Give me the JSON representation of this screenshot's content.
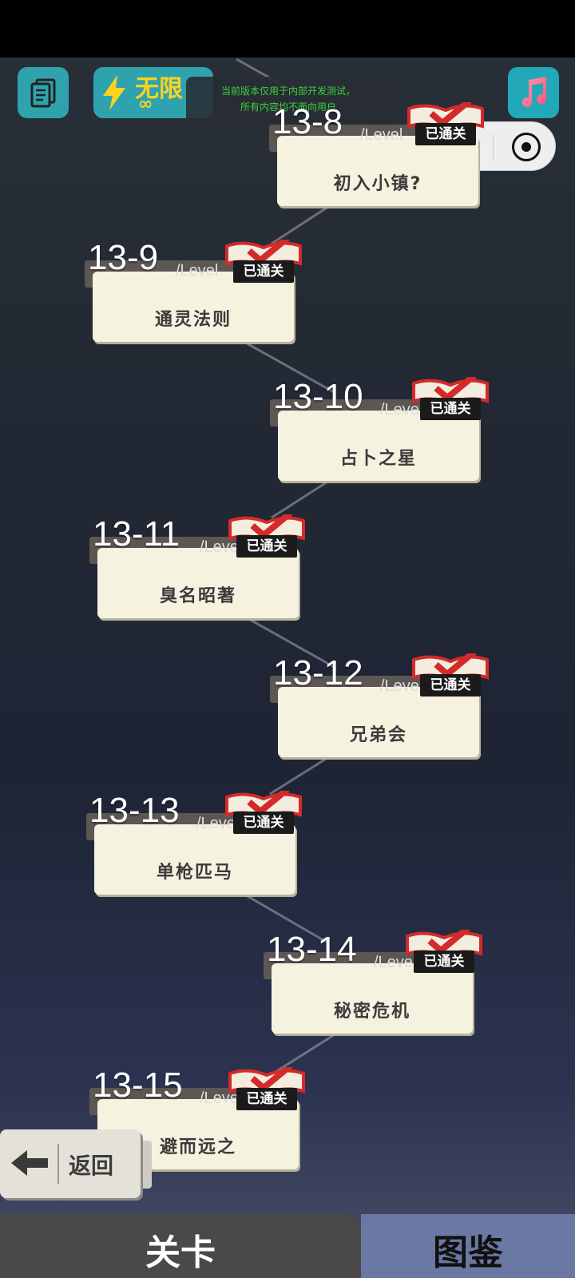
{
  "top_bar": {
    "energy_label": "无限",
    "energy_value": "∞",
    "notice_line1": "当前版本仅用于内部开发测试，",
    "notice_line2": "所有内容均不面向用户"
  },
  "levels": [
    {
      "number": "13-8",
      "level_tag": "/Level",
      "name": "初入小镇?",
      "badge": "已通关"
    },
    {
      "number": "13-9",
      "level_tag": "/Level",
      "name": "通灵法则",
      "badge": "已通关"
    },
    {
      "number": "13-10",
      "level_tag": "/Level",
      "name": "占卜之星",
      "badge": "已通关"
    },
    {
      "number": "13-11",
      "level_tag": "/Level",
      "name": "臭名昭著",
      "badge": "已通关"
    },
    {
      "number": "13-12",
      "level_tag": "/Level",
      "name": "兄弟会",
      "badge": "已通关"
    },
    {
      "number": "13-13",
      "level_tag": "/Level",
      "name": "单枪匹马",
      "badge": "已通关"
    },
    {
      "number": "13-14",
      "level_tag": "/Level",
      "name": "秘密危机",
      "badge": "已通关"
    },
    {
      "number": "13-15",
      "level_tag": "/Level",
      "name": "避而远之",
      "badge": "已通关"
    }
  ],
  "back_button": {
    "label": "返回"
  },
  "bottom_nav": {
    "levels_label": "关卡",
    "atlas_label": "图鉴"
  },
  "colors": {
    "accent_teal": "#2fa3ad",
    "badge_red": "#d42a2a",
    "card": "#f6f2e0",
    "nav_active": "#4a4948",
    "nav_inactive": "#6b78a3"
  }
}
